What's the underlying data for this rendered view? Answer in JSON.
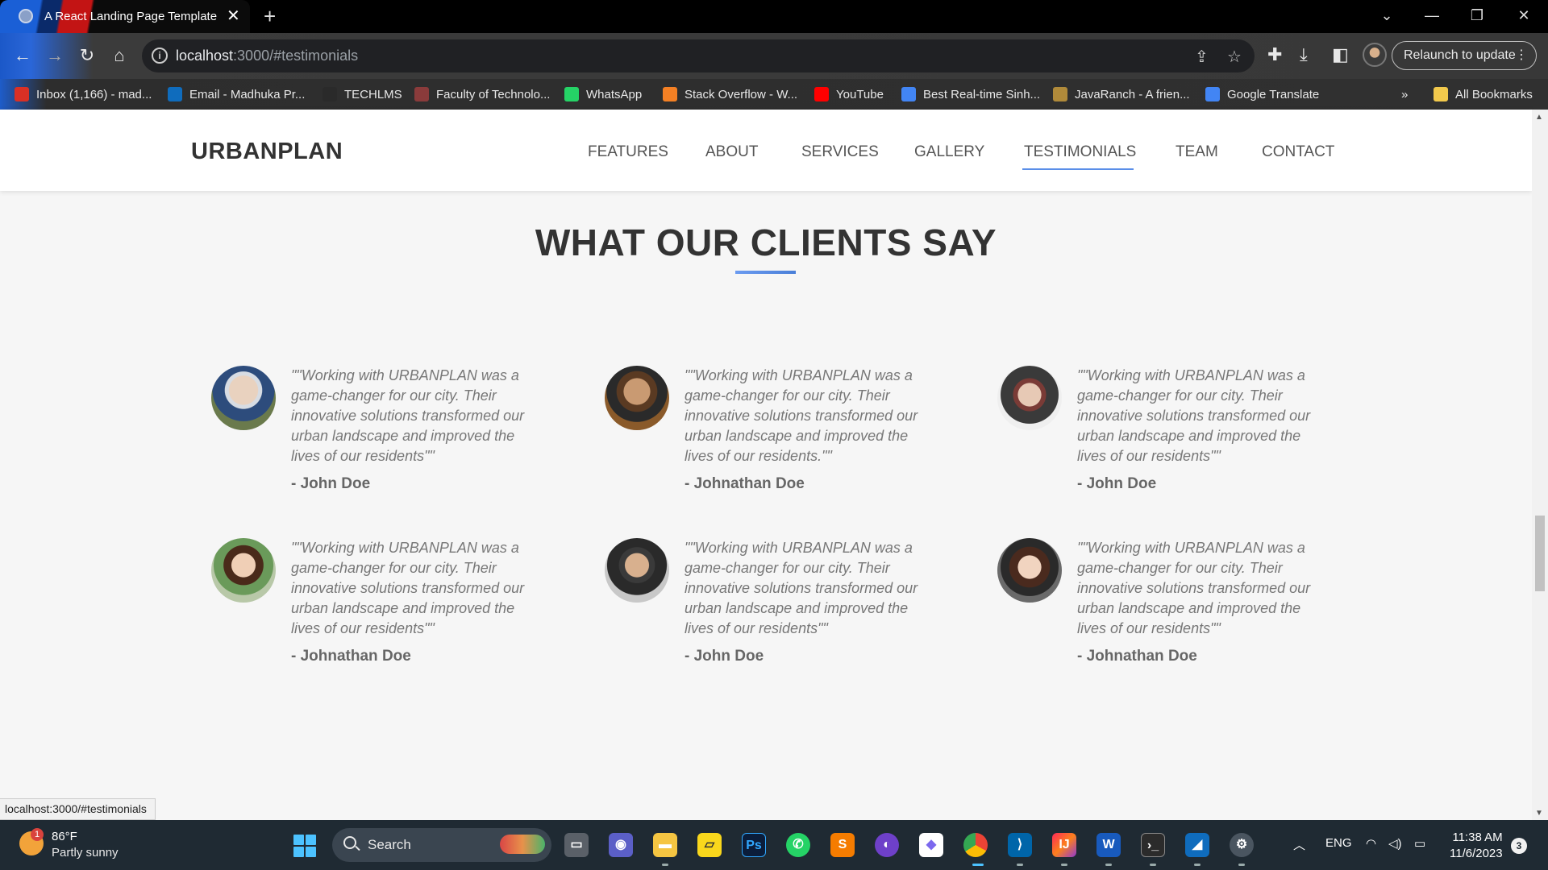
{
  "browser": {
    "tab_title": "A React Landing Page Template",
    "url_host": "localhost",
    "url_rest": ":3000/#testimonials",
    "relaunch_label": "Relaunch to update",
    "bookmarks": [
      {
        "label": "Inbox (1,166) - mad...",
        "icon": "gmail-icon",
        "color": "#d93025"
      },
      {
        "label": "Email - Madhuka Pr...",
        "icon": "outlook-icon",
        "color": "#0f6cbd"
      },
      {
        "label": "TECHLMS",
        "icon": "techlms-icon",
        "color": "#2a2a2a"
      },
      {
        "label": "Faculty of Technolo...",
        "icon": "university-icon",
        "color": "#8a3b3b"
      },
      {
        "label": "WhatsApp",
        "icon": "whatsapp-icon",
        "color": "#25d366"
      },
      {
        "label": "Stack Overflow - W...",
        "icon": "stackoverflow-icon",
        "color": "#f48024"
      },
      {
        "label": "YouTube",
        "icon": "youtube-icon",
        "color": "#ff0000"
      },
      {
        "label": "Best Real-time Sinh...",
        "icon": "google-icon",
        "color": "#4285f4"
      },
      {
        "label": "JavaRanch - A frien...",
        "icon": "javaranch-icon",
        "color": "#b08a3a"
      },
      {
        "label": "Google Translate",
        "icon": "translate-icon",
        "color": "#4285f4"
      }
    ],
    "more_bookmarks": "»",
    "all_bookmarks": "All Bookmarks",
    "status_url": "localhost:3000/#testimonials"
  },
  "site": {
    "brand": "URBANPLAN",
    "menu": [
      "FEATURES",
      "ABOUT",
      "SERVICES",
      "GALLERY",
      "TESTIMONIALS",
      "TEAM",
      "CONTACT"
    ],
    "active_menu": "TESTIMONIALS",
    "section_title": "WHAT OUR CLIENTS SAY",
    "accent_color": "#5a8ee8"
  },
  "testimonials": [
    {
      "quote": "\"\"Working with URBANPLAN was a game-changer for our city. Their innovative solutions transformed our urban landscape and improved the lives of our residents\"\"",
      "author": "- John Doe"
    },
    {
      "quote": "\"\"Working with URBANPLAN was a game-changer for our city. Their innovative solutions transformed our urban landscape and improved the lives of our residents.\"\"",
      "author": "- Johnathan Doe"
    },
    {
      "quote": "\"\"Working with URBANPLAN was a game-changer for our city. Their innovative solutions transformed our urban landscape and improved the lives of our residents\"\"",
      "author": "- John Doe"
    },
    {
      "quote": "\"\"Working with URBANPLAN was a game-changer for our city. Their innovative solutions transformed our urban landscape and improved the lives of our residents\"\"",
      "author": "- Johnathan Doe"
    },
    {
      "quote": "\"\"Working with URBANPLAN was a game-changer for our city. Their innovative solutions transformed our urban landscape and improved the lives of our residents\"\"",
      "author": "- John Doe"
    },
    {
      "quote": "\"\"Working with URBANPLAN was a game-changer for our city. Their innovative solutions transformed our urban landscape and improved the lives of our residents\"\"",
      "author": "- Johnathan Doe"
    }
  ],
  "taskbar": {
    "weather_temp": "86°F",
    "weather_desc": "Partly sunny",
    "weather_badge": "1",
    "search_label": "Search",
    "lang": "ENG",
    "time": "11:38 AM",
    "date": "11/6/2023",
    "notifications": "3"
  }
}
